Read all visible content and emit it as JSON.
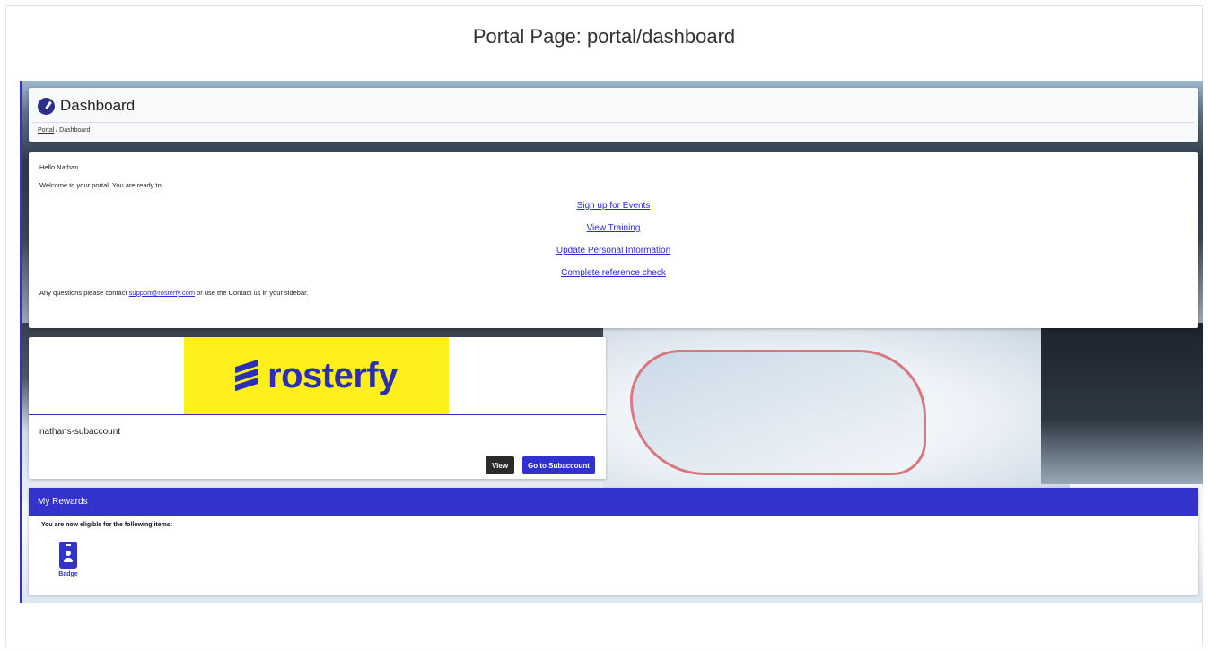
{
  "page_title": "Portal Page: portal/dashboard",
  "header": {
    "title": "Dashboard",
    "icon": "dashboard-icon",
    "breadcrumb": {
      "root": "Portal",
      "separator": "/",
      "current": "Dashboard"
    }
  },
  "welcome": {
    "greeting": "Hello Nathan",
    "intro": "Welcome to your portal. You are ready to:",
    "links": [
      "Sign up for Events",
      "View Training",
      "Update Personal Information",
      "Complete reference check"
    ],
    "questions_prefix": "Any questions please contact ",
    "support_email": "support@rosterfy.com",
    "questions_suffix": " or use the Contact us in your sidebar."
  },
  "subaccount": {
    "logo_text": "rosterfy",
    "name": "nathans-subaccount",
    "view_label": "View",
    "go_label": "Go to Subaccount"
  },
  "rewards": {
    "title": "My Rewards",
    "subtitle": "You are now eligible for the following items:",
    "items": [
      {
        "label": "Badge",
        "icon": "badge-icon"
      }
    ]
  },
  "colors": {
    "accent": "#3333cc",
    "logo_bg": "#ffef1a",
    "link": "#2a2ad6"
  }
}
